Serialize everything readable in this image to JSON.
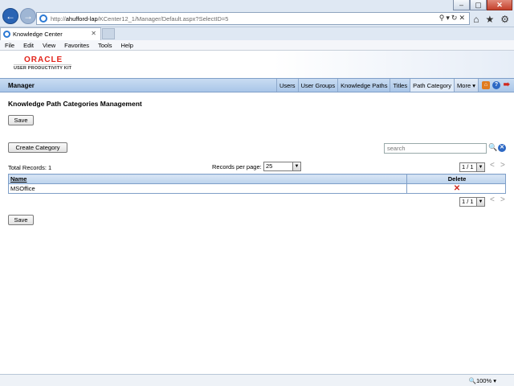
{
  "browser": {
    "url_prefix": "http://",
    "url_host": "ahufford-lap",
    "url_path": "/KCenter12_1/Manager/Default.aspx?SelectID=5",
    "tab_title": "Knowledge Center",
    "menu": [
      "File",
      "Edit",
      "View",
      "Favorites",
      "Tools",
      "Help"
    ],
    "zoom": "100%"
  },
  "header": {
    "logo": "ORACLE",
    "product": "USER PRODUCTIVITY KIT"
  },
  "navbar": {
    "title": "Manager",
    "links": [
      "Users",
      "User Groups",
      "Knowledge Paths",
      "Titles",
      "Path Category",
      "More"
    ]
  },
  "main": {
    "title": "Knowledge Path Categories Management",
    "save_label": "Save",
    "create_label": "Create Category",
    "search_placeholder": "search",
    "total_records": "Total Records: 1",
    "records_per_page_label": "Records per page:",
    "records_per_page_value": "25",
    "page_value": "1 / 1",
    "columns": [
      "Name",
      "Delete"
    ],
    "rows": [
      {
        "name": "MSOffice"
      }
    ]
  }
}
